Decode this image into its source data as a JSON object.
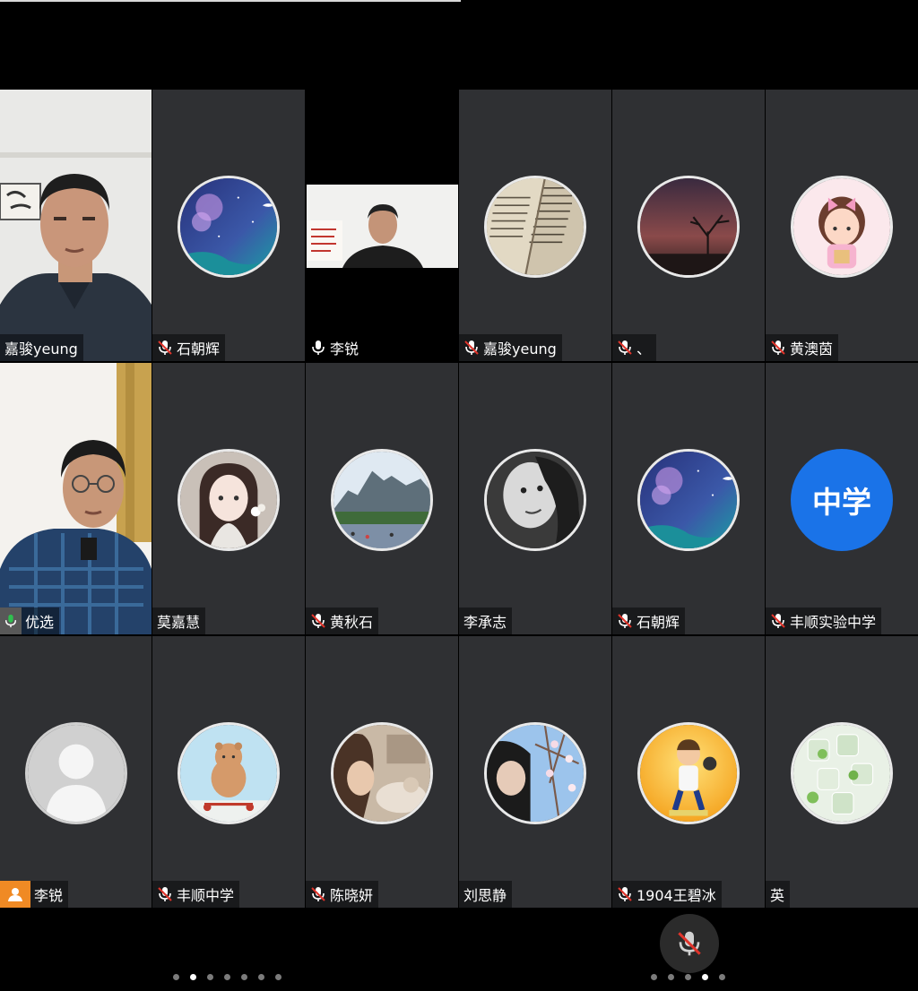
{
  "tiles": [
    {
      "name": "嘉骏yeung",
      "mic": "none",
      "type": "video"
    },
    {
      "name": "石朝辉",
      "mic": "muted",
      "type": "avatar",
      "avatar": "galaxy"
    },
    {
      "name": "李锐",
      "mic": "on",
      "type": "video"
    },
    {
      "name": "嘉骏yeung",
      "mic": "muted",
      "type": "avatar",
      "avatar": "book"
    },
    {
      "name": "、",
      "mic": "muted",
      "type": "avatar",
      "avatar": "dusk-tree"
    },
    {
      "name": "黄澳茵",
      "mic": "muted",
      "type": "avatar",
      "avatar": "cartoon-girl"
    },
    {
      "name": "优选",
      "mic": "speaking",
      "type": "video"
    },
    {
      "name": "莫嘉慧",
      "mic": "none",
      "type": "avatar",
      "avatar": "anime-girl"
    },
    {
      "name": "黄秋石",
      "mic": "muted",
      "type": "avatar",
      "avatar": "mountains"
    },
    {
      "name": "李承志",
      "mic": "none",
      "type": "avatar",
      "avatar": "bw-portrait"
    },
    {
      "name": "石朝辉",
      "mic": "muted",
      "type": "avatar",
      "avatar": "galaxy"
    },
    {
      "name": "丰顺实验中学",
      "mic": "muted",
      "type": "text-avatar",
      "avatar_text": "中学"
    },
    {
      "name": "李锐",
      "mic": "guest",
      "type": "avatar",
      "avatar": "default-person"
    },
    {
      "name": "丰顺中学",
      "mic": "muted",
      "type": "avatar",
      "avatar": "bear-scooter"
    },
    {
      "name": "陈晓妍",
      "mic": "muted",
      "type": "avatar",
      "avatar": "girl-cat"
    },
    {
      "name": "刘思静",
      "mic": "none",
      "type": "avatar",
      "avatar": "blossoms"
    },
    {
      "name": "1904王碧冰",
      "mic": "muted",
      "type": "avatar",
      "avatar": "baseball-boy"
    },
    {
      "name": "英",
      "mic": "none",
      "type": "avatar",
      "avatar": "ice-cubes"
    }
  ],
  "pager_left": {
    "count": 7,
    "active": 1
  },
  "pager_right": {
    "count": 5,
    "active": 3
  },
  "controls": {
    "mic_button": "mic-muted-icon"
  },
  "colors": {
    "tile_bg": "#2f3033",
    "speaking_border": "#2fbf4f",
    "muted_red": "#e0342b",
    "school_avatar_blue": "#1a73e8",
    "guest_badge_orange": "#f08a24"
  }
}
